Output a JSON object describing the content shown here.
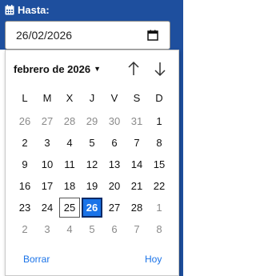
{
  "field": {
    "label": "Hasta:",
    "value": "26/02/2026"
  },
  "calendar": {
    "month_year": "febrero de 2026",
    "weekdays": [
      "L",
      "M",
      "X",
      "J",
      "V",
      "S",
      "D"
    ],
    "days": [
      {
        "d": "26",
        "other": true
      },
      {
        "d": "27",
        "other": true
      },
      {
        "d": "28",
        "other": true
      },
      {
        "d": "29",
        "other": true
      },
      {
        "d": "30",
        "other": true
      },
      {
        "d": "31",
        "other": true
      },
      {
        "d": "1"
      },
      {
        "d": "2"
      },
      {
        "d": "3"
      },
      {
        "d": "4"
      },
      {
        "d": "5"
      },
      {
        "d": "6"
      },
      {
        "d": "7"
      },
      {
        "d": "8"
      },
      {
        "d": "9"
      },
      {
        "d": "10"
      },
      {
        "d": "11"
      },
      {
        "d": "12"
      },
      {
        "d": "13"
      },
      {
        "d": "14"
      },
      {
        "d": "15"
      },
      {
        "d": "16"
      },
      {
        "d": "17"
      },
      {
        "d": "18"
      },
      {
        "d": "19"
      },
      {
        "d": "20"
      },
      {
        "d": "21"
      },
      {
        "d": "22"
      },
      {
        "d": "23"
      },
      {
        "d": "24"
      },
      {
        "d": "25",
        "today": true
      },
      {
        "d": "26",
        "selected": true
      },
      {
        "d": "27"
      },
      {
        "d": "28"
      },
      {
        "d": "1",
        "other": true
      },
      {
        "d": "2",
        "other": true
      },
      {
        "d": "3",
        "other": true
      },
      {
        "d": "4",
        "other": true
      },
      {
        "d": "5",
        "other": true
      },
      {
        "d": "6",
        "other": true
      },
      {
        "d": "7",
        "other": true
      },
      {
        "d": "8",
        "other": true
      }
    ],
    "clear_label": "Borrar",
    "today_label": "Hoy"
  },
  "colors": {
    "header_bg": "#1e4f9e",
    "accent": "#1a73e8",
    "selected_border": "#0b2a66"
  },
  "icons": {
    "field": "calendar-icon",
    "picker": "calendar-picker-icon",
    "prev": "arrow-up-icon",
    "next": "arrow-down-icon",
    "month_dropdown": "caret-down-icon"
  }
}
